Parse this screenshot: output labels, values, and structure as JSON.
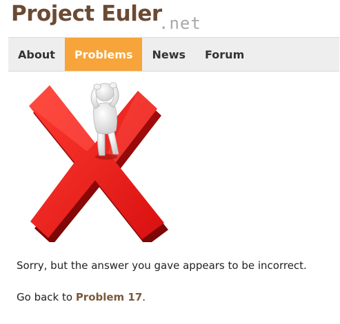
{
  "logo": {
    "main": "Project Euler",
    "suffix": ".net"
  },
  "nav": {
    "items": [
      {
        "label": "About",
        "active": false
      },
      {
        "label": "Problems",
        "active": true
      },
      {
        "label": "News",
        "active": false
      },
      {
        "label": "Forum",
        "active": false
      }
    ]
  },
  "colors": {
    "brand": "#6b4a33",
    "accent": "#f7a43a",
    "link": "#7a5a3c",
    "cross": "#e21b1b"
  },
  "illustration": {
    "icon": "red-cross-with-figure-icon"
  },
  "result": {
    "message": "Sorry, but the answer you gave appears to be incorrect.",
    "go_back_prefix": "Go back to ",
    "problem_link": "Problem 17",
    "go_back_suffix": "."
  }
}
